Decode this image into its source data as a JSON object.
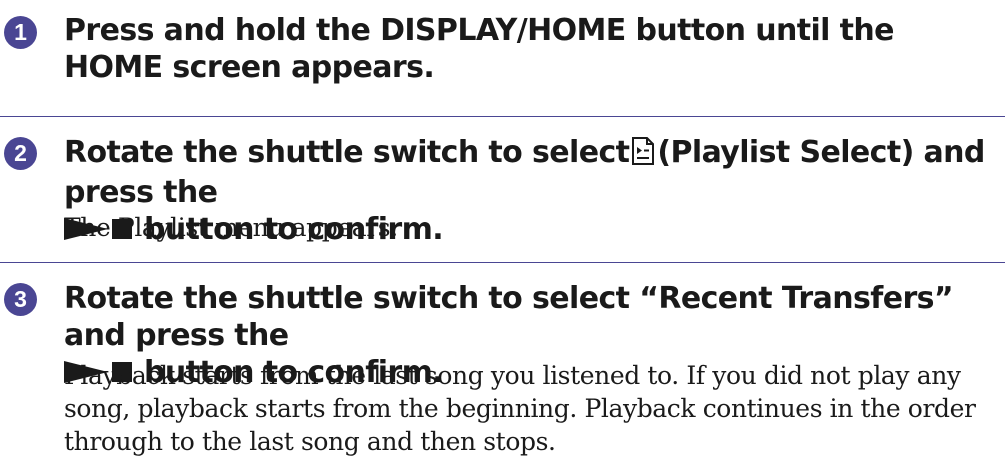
{
  "steps": [
    {
      "number": "1",
      "heading": "Press and hold the DISPLAY/HOME button until the HOME screen appears."
    },
    {
      "number": "2",
      "heading_before_icon": "Rotate the shuttle switch to select",
      "heading_after_icon": "(Playlist Select) and press the",
      "heading_line2": "button to confirm.",
      "body": "The Playlist menu appears.",
      "icons": [
        "playlist-select-icon",
        "play-stop-icon"
      ]
    },
    {
      "number": "3",
      "heading_line1": "Rotate the shuttle switch to select “Recent Transfers” and press the",
      "heading_line2": "button to confirm.",
      "body": "Playback starts from the last song you listened to. If you did not play any song, playback starts from the beginning. Playback continues in the order through to the last song and then stops.",
      "icons": [
        "play-stop-icon"
      ]
    }
  ],
  "colors": {
    "accent": "#4a4693",
    "text": "#1a1a1a",
    "background": "#ffffff"
  }
}
